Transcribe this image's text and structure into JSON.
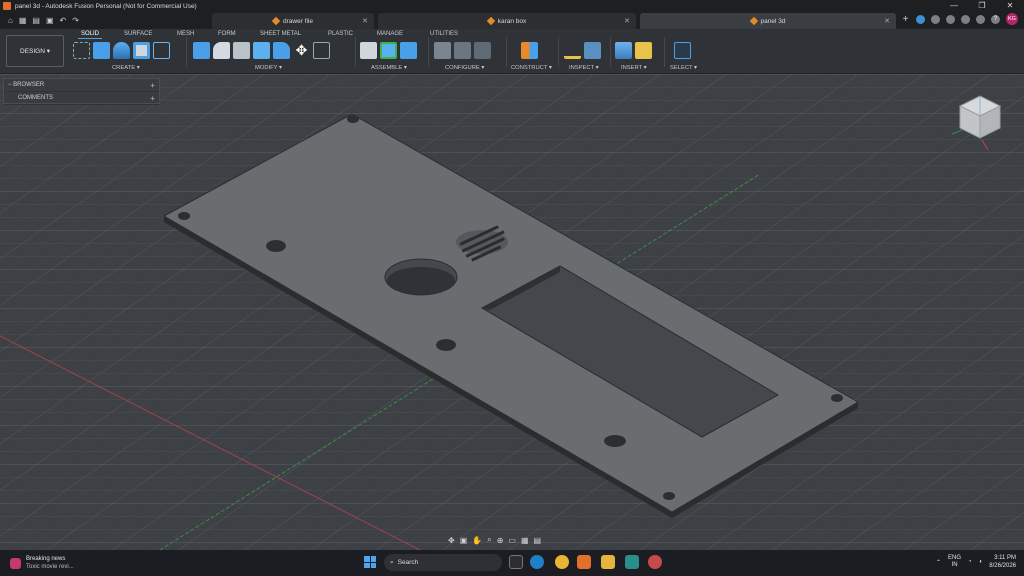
{
  "window": {
    "title": "panel 3d - Autodesk Fusion Personal (Not for Commercial Use)",
    "controls": [
      "—",
      "❐",
      "✕"
    ]
  },
  "doc_tabs": [
    {
      "label": "drawer file"
    },
    {
      "label": "karan box"
    },
    {
      "label": "panel 3d"
    }
  ],
  "user_initials": "KG",
  "ribbon": {
    "workspace": "DESIGN",
    "workspace_tabs": [
      "SOLID",
      "SURFACE",
      "MESH",
      "FORM",
      "SHEET METAL",
      "PLASTIC",
      "MANAGE",
      "UTILITIES"
    ],
    "groups": [
      "CREATE ▾",
      "MODIFY ▾",
      "ASSEMBLE ▾",
      "CONFIGURE ▾",
      "CONSTRUCT ▾",
      "INSPECT ▾",
      "INSERT ▾",
      "SELECT ▾"
    ]
  },
  "browser_panel": {
    "items": [
      {
        "label": "BROWSER"
      },
      {
        "label": "COMMENTS"
      }
    ]
  },
  "taskbar": {
    "news_title": "Breaking news",
    "news_subtitle": "Toxic movie revi...",
    "search_label": "Search",
    "lang_line1": "ENG",
    "lang_line2": "IN",
    "time": "3:11 PM",
    "date": "8/26/2026"
  },
  "colors": {
    "accent": "#49a0e6",
    "brand_orange": "#e2702a",
    "panel_fill": "#6a6d70"
  }
}
